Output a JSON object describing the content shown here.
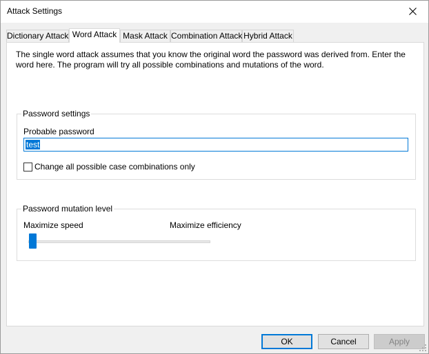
{
  "window": {
    "title": "Attack Settings",
    "close_icon": "close-icon"
  },
  "tabs": [
    {
      "label": "Dictionary Attack",
      "active": false
    },
    {
      "label": "Word Attack",
      "active": true
    },
    {
      "label": "Mask Attack",
      "active": false
    },
    {
      "label": "Combination Attack",
      "active": false
    },
    {
      "label": "Hybrid Attack",
      "active": false
    }
  ],
  "word_attack": {
    "description": "The single word attack assumes that you know the original word the password was derived from. Enter the word here. The program will try all possible combinations and mutations of the word.",
    "password_settings": {
      "group_title": "Password settings",
      "probable_password_label": "Probable password",
      "probable_password_value": "test",
      "case_checkbox_label": "Change all possible case combinations only",
      "case_checkbox_checked": false
    },
    "mutation": {
      "group_title": "Password mutation level",
      "min_label": "Maximize speed",
      "max_label": "Maximize efficiency",
      "level": 0
    }
  },
  "buttons": {
    "ok": "OK",
    "cancel": "Cancel",
    "apply": "Apply"
  },
  "colors": {
    "accent": "#0078d7",
    "panel_bg": "#ffffff",
    "window_bg": "#f0f0f0"
  }
}
